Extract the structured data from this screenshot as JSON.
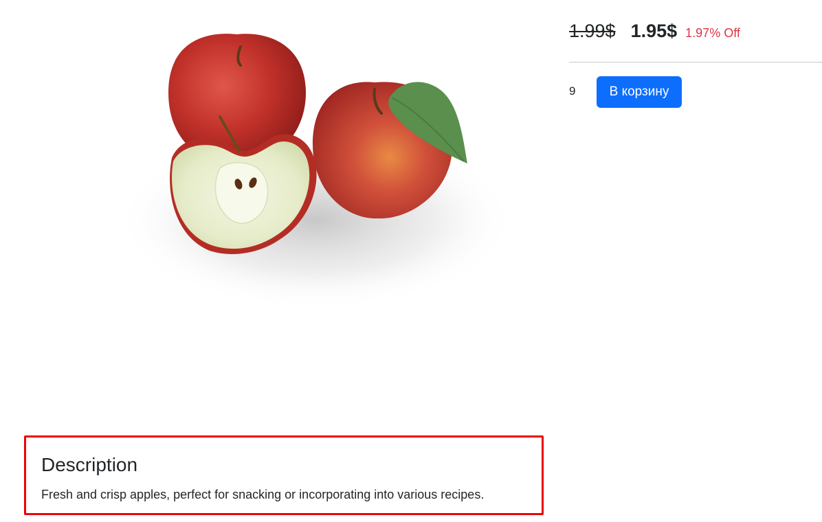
{
  "product": {
    "image_name": "apples-image",
    "old_price": "1.99$",
    "new_price": "1.95$",
    "discount": "1.97% Off",
    "quantity": "9",
    "add_to_cart_label": "В корзину"
  },
  "description": {
    "title": "Description",
    "text": "Fresh and crisp apples, perfect for snacking or incorporating into various recipes."
  },
  "colors": {
    "primary_button": "#0d6efd",
    "discount": "#dc3545",
    "highlight_border": "#ee0000"
  }
}
